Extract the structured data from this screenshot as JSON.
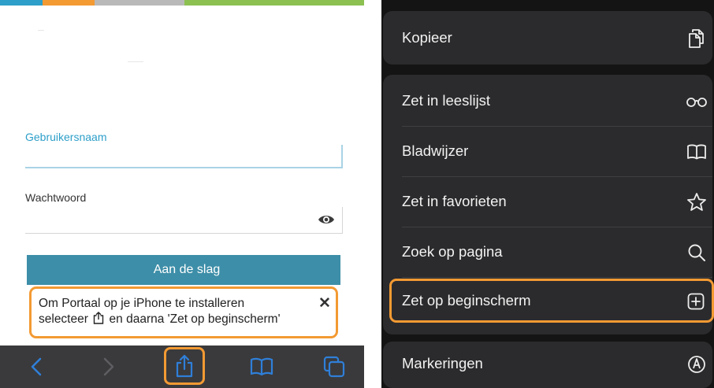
{
  "accent": {
    "highlight": "#f39a33",
    "primary_button": "#3d8ea8",
    "field_active": "#2d9fc9",
    "top_stripes": [
      "#2d9fc9",
      "#f39a33",
      "#b9b9b9",
      "#8cc152"
    ]
  },
  "login": {
    "username_label": "Gebruikersnaam",
    "username_value": "",
    "password_label": "Wachtwoord",
    "password_value": "",
    "password_toggle_icon": "eye-icon",
    "submit_label": "Aan de slag"
  },
  "install_banner": {
    "line1": "Om Portaal op je iPhone te installeren",
    "line2_before": "selecteer",
    "line2_icon": "share-icon",
    "line2_after": "en daarna 'Zet op beginscherm'",
    "close_glyph": "✕"
  },
  "browser_toolbar": {
    "buttons": [
      {
        "name": "back",
        "icon": "chevron-left-icon"
      },
      {
        "name": "forward",
        "icon": "chevron-right-icon"
      },
      {
        "name": "share",
        "icon": "share-icon"
      },
      {
        "name": "bookmarks",
        "icon": "book-icon"
      },
      {
        "name": "tabs",
        "icon": "tabs-icon"
      }
    ]
  },
  "share_sheet": {
    "items": [
      {
        "label": "Kopieer",
        "icon": "copy-icon"
      },
      {
        "label": "Zet in leeslijst",
        "icon": "glasses-icon"
      },
      {
        "label": "Bladwijzer",
        "icon": "book-icon"
      },
      {
        "label": "Zet in favorieten",
        "icon": "star-icon"
      },
      {
        "label": "Zoek op pagina",
        "icon": "search-icon"
      },
      {
        "label": "Zet op beginscherm",
        "icon": "add-square-icon"
      },
      {
        "label": "Markeringen",
        "icon": "markup-icon"
      }
    ]
  }
}
